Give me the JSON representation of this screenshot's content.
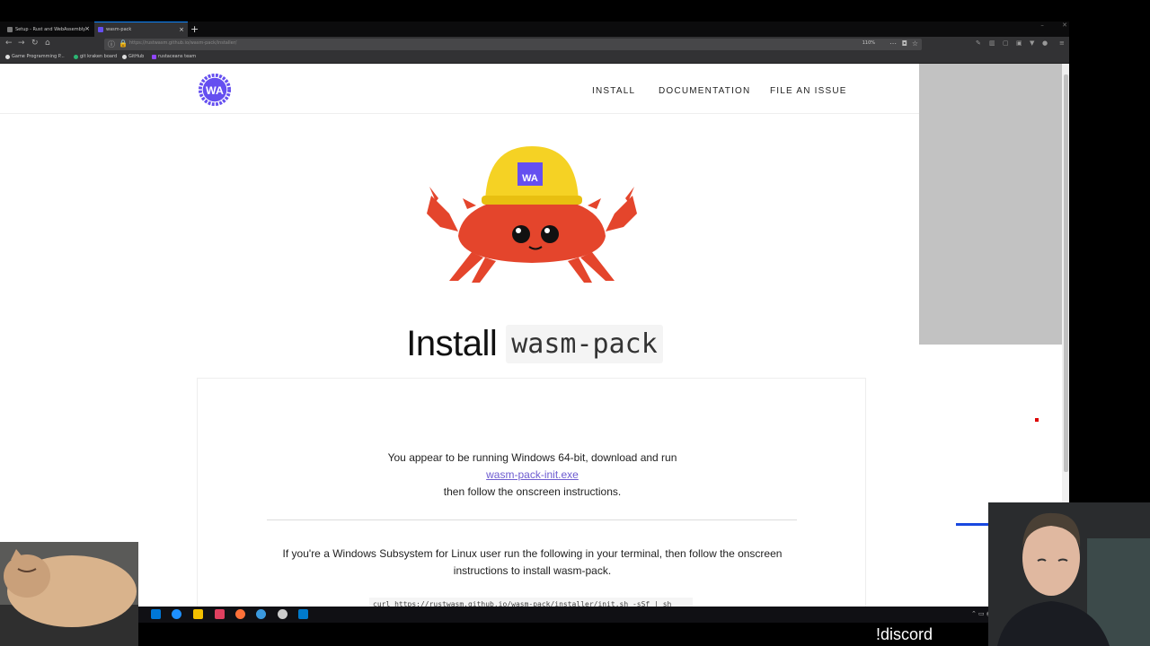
{
  "browser": {
    "tabs": [
      {
        "label": "Setup - Rust and WebAssembly",
        "favicon_color": "#777777"
      },
      {
        "label": "wasm-pack",
        "favicon_color": "#654ff0"
      }
    ],
    "new_tab_label": "+",
    "url": "https://rustwasm.github.io/wasm-pack/installer/",
    "zoom": "110%",
    "bookmarks": [
      {
        "label": "Game Programming P...",
        "icon_color": "#e0e0e0"
      },
      {
        "label": "git kraken board",
        "icon_color": "#2bb673"
      },
      {
        "label": "GitHub",
        "icon_color": "#dddddd"
      },
      {
        "label": "rustaceans team",
        "icon_color": "#9146ff"
      }
    ]
  },
  "site": {
    "logo_text": "WA",
    "nav": [
      "INSTALL",
      "DOCUMENTATION",
      "FILE AN ISSUE"
    ],
    "heading": "Install",
    "heading_code": "wasm-pack",
    "helmet_text": "WA",
    "windows_msg": "You appear to be running Windows 64-bit, download and run",
    "download_link": "wasm-pack-init.exe",
    "windows_msg2": "then follow the onscreen instructions.",
    "wsl_msg1": "If you're a Windows Subsystem for Linux user run the following in your terminal, then follow the onscreen",
    "wsl_msg2": "instructions to install wasm-pack.",
    "curl_cmd": "curl https://rustwasm.github.io/wasm-pack/installer/init.sh -sSf | sh",
    "colors": {
      "accent": "#654ff0",
      "crab": "#e4452c",
      "helmet": "#f5d224",
      "link": "#6d5bd0"
    }
  },
  "stream": {
    "discord_label": "!discord"
  }
}
